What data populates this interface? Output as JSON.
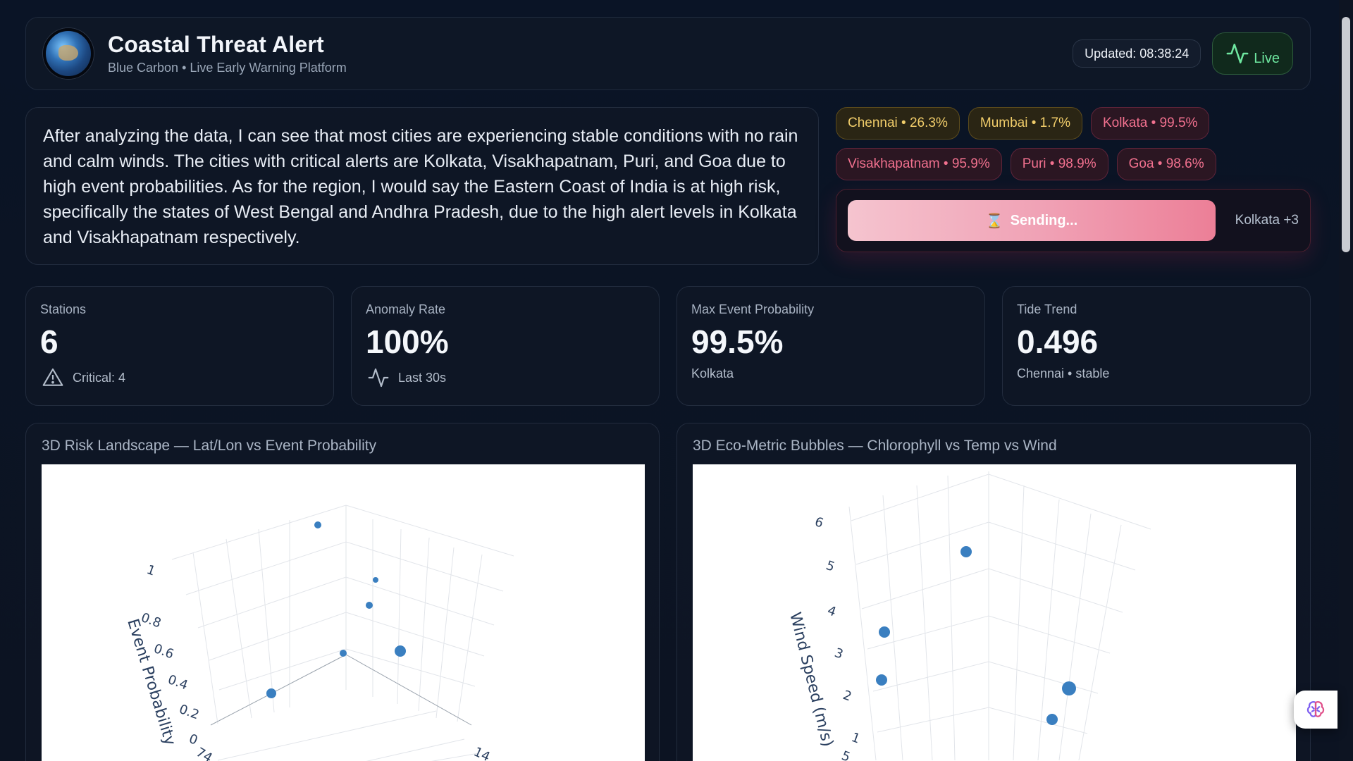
{
  "header": {
    "title": "Coastal Threat Alert",
    "subtitle": "Blue Carbon • Live Early Warning Platform",
    "updated": "Updated: 08:38:24",
    "live_label": "Live"
  },
  "summary": {
    "text": "After analyzing the data, I can see that most cities are experiencing stable conditions with no rain and calm winds. The cities with critical alerts are Kolkata, Visakhapatnam, Puri, and Goa due to high event probabilities. As for the region, I would say the Eastern Coast of India is at high risk, specifically the states of West Bengal and Andhra Pradesh, due to the high alert levels in Kolkata and Visakhapatnam respectively."
  },
  "alerts": {
    "chips": [
      {
        "label": "Chennai • 26.3%",
        "level": "warn"
      },
      {
        "label": "Mumbai • 1.7%",
        "level": "warn"
      },
      {
        "label": "Kolkata • 99.5%",
        "level": "crit"
      },
      {
        "label": "Visakhapatnam • 95.9%",
        "level": "crit"
      },
      {
        "label": "Puri • 98.9%",
        "level": "crit"
      },
      {
        "label": "Goa • 98.6%",
        "level": "crit"
      }
    ],
    "send_button": "Sending...",
    "send_icon": "⌛",
    "send_target": "Kolkata +3"
  },
  "stats": [
    {
      "label": "Stations",
      "value": "6",
      "sub": "Critical: 4",
      "icon": "warning-icon"
    },
    {
      "label": "Anomaly Rate",
      "value": "100%",
      "sub": "Last 30s",
      "icon": "activity-icon"
    },
    {
      "label": "Max Event Probability",
      "value": "99.5%",
      "sub": "Kolkata",
      "icon": ""
    },
    {
      "label": "Tide Trend",
      "value": "0.496",
      "sub": "Chennai • stable",
      "icon": ""
    }
  ],
  "charts": {
    "left_title": "3D Risk Landscape — Lat/Lon vs Event Probability",
    "right_title": "3D Eco-Metric Bubbles — Chlorophyll vs Temp vs Wind",
    "left_axis_title": "Event Probability",
    "left_ticks": [
      "0",
      "0.2",
      "0.4",
      "0.6",
      "0.8",
      "1"
    ],
    "left_extra_ticks": [
      "74",
      "14"
    ],
    "right_axis_title": "Wind Speed (m/s)",
    "right_ticks": [
      "1",
      "2",
      "3",
      "4",
      "5",
      "6"
    ],
    "right_extra_ticks": [
      "5"
    ]
  },
  "chart_data": [
    {
      "type": "scatter",
      "title": "3D Risk Landscape — Lat/Lon vs Event Probability",
      "zlabel": "Event Probability",
      "zlim": [
        0,
        1
      ],
      "z_values": [
        0.995,
        0.959,
        0.989,
        0.986,
        0.263,
        0.017
      ]
    },
    {
      "type": "scatter",
      "title": "3D Eco-Metric Bubbles — Chlorophyll vs Temp vs Wind",
      "zlabel": "Wind Speed (m/s)",
      "zlim": [
        1,
        6
      ]
    }
  ],
  "colors": {
    "marker": "#3a7fc0",
    "critical": "#f2718f",
    "warning": "#f1cd6a",
    "live": "#6ee7a0"
  }
}
